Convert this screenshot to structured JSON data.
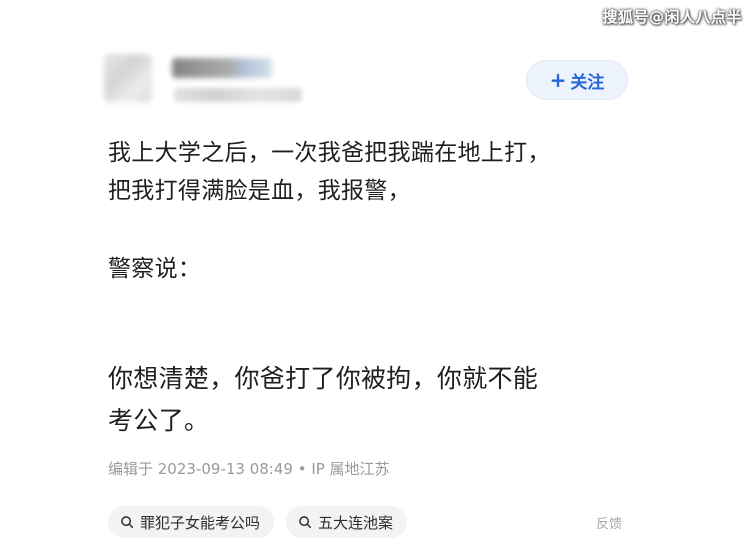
{
  "watermark": "搜狐号@闲人八点半",
  "header": {
    "follow_label": "关注",
    "follow_icon": "plus-icon"
  },
  "post": {
    "paragraph_1": [
      "我上大学之后，一次我爸把我踹在地上打，",
      "把我打得满脸是血，我报警，"
    ],
    "paragraph_2": "警察说：",
    "paragraph_3": [
      "你想清楚，你爸打了你被拘，你就不能",
      "考公了。"
    ]
  },
  "edit_info": "编辑于 2023-09-13 08:49 • IP 属地江苏",
  "tags": [
    {
      "label": "罪犯子女能考公吗",
      "icon": "search-icon"
    },
    {
      "label": "五大连池案",
      "icon": "search-icon"
    }
  ],
  "feedback_label": "反馈",
  "colors": {
    "accent": "#2466d8",
    "follow_bg": "#edf3fc",
    "tag_bg": "#f2f3f5",
    "meta_text": "#9a9a9a"
  }
}
